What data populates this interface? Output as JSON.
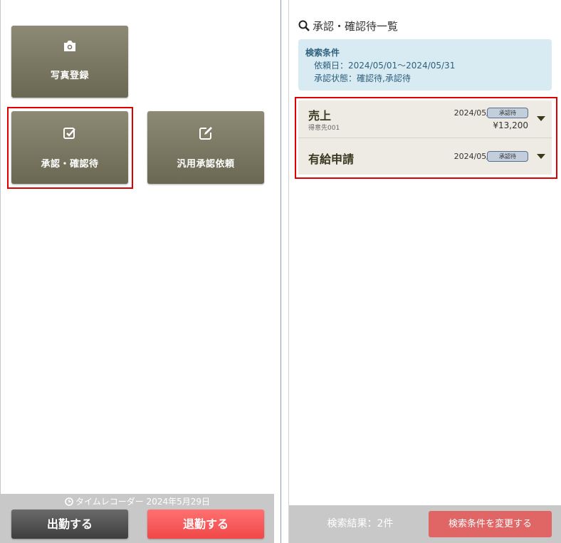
{
  "menu": {
    "photo_label": "写真登録",
    "approve_label": "承認・確認待",
    "general_label": "汎用承認依頼"
  },
  "time_recorder": {
    "title": "タイムレコーダー 2024年5月29日",
    "clock_in_label": "出勤する",
    "clock_out_label": "退勤する"
  },
  "approval_list": {
    "title": "承認・確認待一覧",
    "criteria": {
      "heading": "検索条件",
      "date_range": "依頼日：2024/05/01～2024/05/31",
      "status": "承認状態：確認待,承認待"
    },
    "items": [
      {
        "title": "売上",
        "subtitle": "得意先001",
        "date": "2024/05/29",
        "badge": "承認待",
        "amount": "¥13,200"
      },
      {
        "title": "有給申請",
        "subtitle": "",
        "date": "2024/05/29",
        "badge": "承認待",
        "amount": ""
      }
    ],
    "result_count": "検索結果：2件",
    "change_criteria_label": "検索条件を変更する"
  },
  "colors": {
    "tile": "#7a7862",
    "clock_in": "#4a4a4a",
    "clock_out": "#f45a5a",
    "criteria_bg": "#d8ebf3",
    "highlight": "#e00000"
  },
  "icons": [
    "camera-icon",
    "check-square-icon",
    "edit-square-icon",
    "clock-icon",
    "search-icon",
    "caret-down-icon"
  ]
}
